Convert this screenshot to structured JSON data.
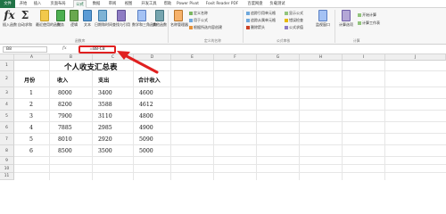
{
  "tabs": [
    "文件",
    "开始",
    "插入",
    "页面布局",
    "公式",
    "数据",
    "审阅",
    "视图",
    "开发工具",
    "帮助",
    "Power Pivot",
    "Foxit Reader PDF",
    "百度网盘",
    "负载测试"
  ],
  "active_tab_index": 4,
  "ribbon": {
    "large_buttons": [
      {
        "label": "插入函数",
        "icon": "function-fx-icon"
      },
      {
        "label": "自动求和",
        "icon": "sigma-icon"
      },
      {
        "label": "最近使用的函数",
        "icon": "recent-functions-icon"
      },
      {
        "label": "财务",
        "icon": "finance-icon"
      },
      {
        "label": "逻辑",
        "icon": "logic-icon"
      },
      {
        "label": "文本",
        "icon": "text-icon"
      },
      {
        "label": "日期和时间",
        "icon": "date-time-icon"
      },
      {
        "label": "查找与引用",
        "icon": "lookup-icon"
      },
      {
        "label": "数学和三角函数",
        "icon": "math-trig-icon"
      },
      {
        "label": "其他函数",
        "icon": "more-functions-icon"
      },
      {
        "label": "名称管理器",
        "icon": "name-manager-icon"
      }
    ],
    "names_group": [
      "定义名称",
      "用于公式",
      "根据所选内容创建"
    ],
    "audit_group": [
      "追踪引用单元格",
      "追踪从属单元格",
      "删除箭头",
      "显示公式",
      "错误检查",
      "公式求值"
    ],
    "watch_label": "监视窗口",
    "calc_options_label": "计算选项",
    "calc_right": [
      "开始计算",
      "计算工作表"
    ],
    "group_labels": [
      "函数库",
      "定义的名称",
      "公式审核",
      "计算"
    ],
    "colors": {
      "accent": "#217346",
      "annotation": "#e02020"
    }
  },
  "formula_bar": {
    "name_box": "B8",
    "fx_label": "fx",
    "formula": "=B8-C8"
  },
  "sheet": {
    "columns": [
      "A",
      "B",
      "C",
      "D",
      "E",
      "F",
      "G",
      "H",
      "I",
      "J"
    ],
    "rows": [
      "1",
      "2",
      "3",
      "4",
      "5",
      "6",
      "7",
      "8",
      "9",
      "10",
      "11",
      "12"
    ],
    "title": "个人收支汇总表",
    "headers": [
      "月份",
      "收入",
      "支出",
      "合计收入"
    ],
    "data": [
      [
        "1",
        "8000",
        "3400",
        "4600"
      ],
      [
        "2",
        "8200",
        "3588",
        "4612"
      ],
      [
        "3",
        "7900",
        "3110",
        "4800"
      ],
      [
        "4",
        "7885",
        "2985",
        "4900"
      ],
      [
        "5",
        "8010",
        "2920",
        "5090"
      ],
      [
        "6",
        "8500",
        "3500",
        "5000"
      ]
    ]
  }
}
